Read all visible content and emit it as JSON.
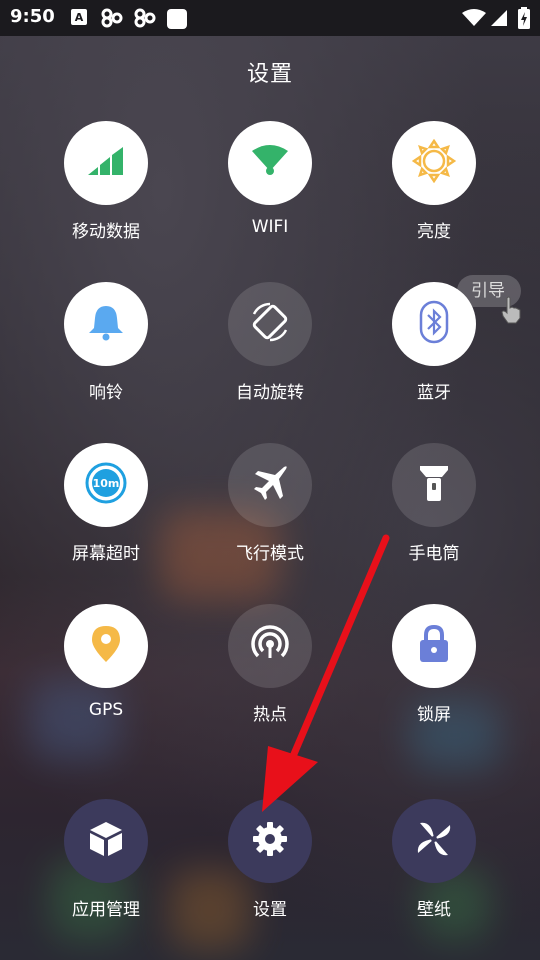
{
  "status_bar": {
    "time": "9:50",
    "left_icons": [
      "a-keyboard-icon",
      "link-icon",
      "link-icon",
      "white-square-icon"
    ],
    "right_icons": [
      "wifi-icon",
      "signal-icon",
      "battery-charging-icon"
    ]
  },
  "panel": {
    "title": "设置",
    "tiles": [
      {
        "label": "移动数据",
        "icon": "signal-bars-icon",
        "state": "on",
        "icon_color": "#34b36a"
      },
      {
        "label": "WIFI",
        "icon": "wifi-icon",
        "state": "on",
        "icon_color": "#34b36a"
      },
      {
        "label": "亮度",
        "icon": "sun-icon",
        "state": "on",
        "icon_color": "#f5b947"
      },
      {
        "label": "响铃",
        "icon": "bell-icon",
        "state": "on",
        "icon_color": "#5aa9f0"
      },
      {
        "label": "自动旋转",
        "icon": "rotate-icon",
        "state": "off",
        "icon_color": "#ffffff"
      },
      {
        "label": "蓝牙",
        "icon": "bluetooth-icon",
        "state": "on",
        "icon_color": "#6b7fd8"
      },
      {
        "label": "屏幕超时",
        "icon": "timeout-10m-icon",
        "state": "on",
        "icon_color": "#1fa0e0",
        "icon_text": "10m"
      },
      {
        "label": "飞行模式",
        "icon": "airplane-icon",
        "state": "off",
        "icon_color": "#ffffff"
      },
      {
        "label": "手电筒",
        "icon": "flashlight-icon",
        "state": "off",
        "icon_color": "#ffffff"
      },
      {
        "label": "GPS",
        "icon": "location-pin-icon",
        "state": "on",
        "icon_color": "#f5b947"
      },
      {
        "label": "热点",
        "icon": "hotspot-icon",
        "state": "off",
        "icon_color": "#ffffff"
      },
      {
        "label": "锁屏",
        "icon": "lock-icon",
        "state": "on",
        "icon_color": "#6b7fd8"
      },
      {
        "label": "应用管理",
        "icon": "box-icon",
        "state": "dark",
        "icon_color": "#ffffff"
      },
      {
        "label": "设置",
        "icon": "gear-icon",
        "state": "dark",
        "icon_color": "#ffffff"
      },
      {
        "label": "壁纸",
        "icon": "pinwheel-icon",
        "state": "dark",
        "icon_color": "#ffffff"
      }
    ]
  },
  "guide_button": {
    "label": "引导"
  },
  "colors": {
    "arrow": "#e8101a",
    "dark_tile": "#3c3a5c"
  }
}
